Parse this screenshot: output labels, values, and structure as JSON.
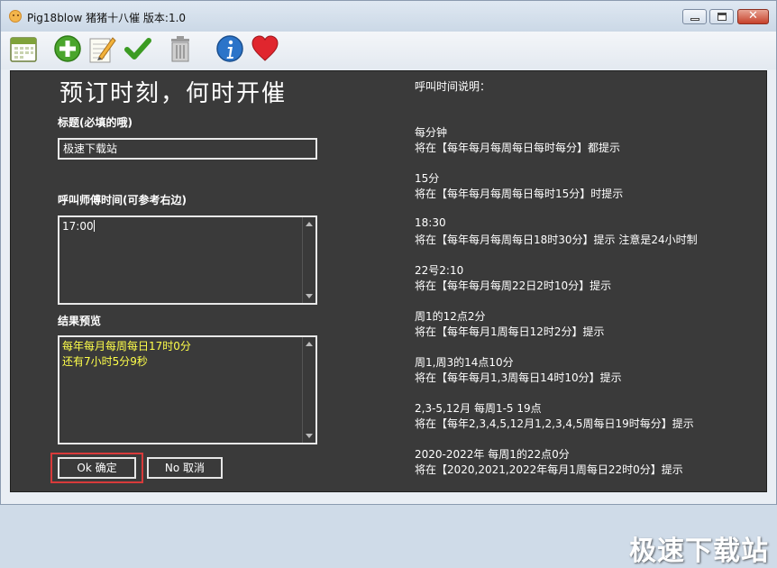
{
  "window": {
    "title": "Pig18blow 猪猪十八催 版本:1.0",
    "controls": {
      "minimize": "",
      "maximize": "",
      "close": "✕"
    }
  },
  "toolbar": {
    "icons": [
      "calendar-icon",
      "add-icon",
      "edit-icon",
      "check-icon",
      "trash-icon",
      "info-icon",
      "heart-icon"
    ]
  },
  "form": {
    "heading": "预订时刻，何时开催",
    "title_label": "标题(必填的哦)",
    "title_value": "极速下载站",
    "time_label": "呼叫师傅时间(可参考右边)",
    "time_value": "17:00",
    "preview_label": "结果预览",
    "preview_lines": [
      "每年每月每周每日17时0分",
      "还有7小时5分9秒"
    ],
    "ok_label": "Ok 确定",
    "cancel_label": "No 取消"
  },
  "help": {
    "title": "呼叫时间说明：",
    "items": [
      {
        "example": "每分钟",
        "desc": "将在【每年每月每周每日每时每分】都提示"
      },
      {
        "example": "15分",
        "desc": "将在【每年每月每周每日每时15分】时提示"
      },
      {
        "example": "18:30",
        "desc": "将在【每年每月每周每日18时30分】提示 注意是24小时制"
      },
      {
        "example": "22号2:10",
        "desc": "将在【每年每月每周22日2时10分】提示"
      },
      {
        "example": "周1的12点2分",
        "desc": "将在【每年每月1周每日12时2分】提示"
      },
      {
        "example": "周1,周3的14点10分",
        "desc": "将在【每年每月1,3周每日14时10分】提示"
      },
      {
        "example": "2,3-5,12月 每周1-5 19点",
        "desc": "将在【每年2,3,4,5,12月1,2,3,4,5周每日19时每分】提示"
      },
      {
        "example": "2020-2022年 每周1的22点0分",
        "desc": "将在【2020,2021,2022年每月1周每日22时0分】提示"
      }
    ]
  },
  "watermark": "极速下载站",
  "colors": {
    "panel_bg": "#3a3a3a",
    "highlight_text": "#ffff4a",
    "highlight_box": "#d83a3a"
  }
}
